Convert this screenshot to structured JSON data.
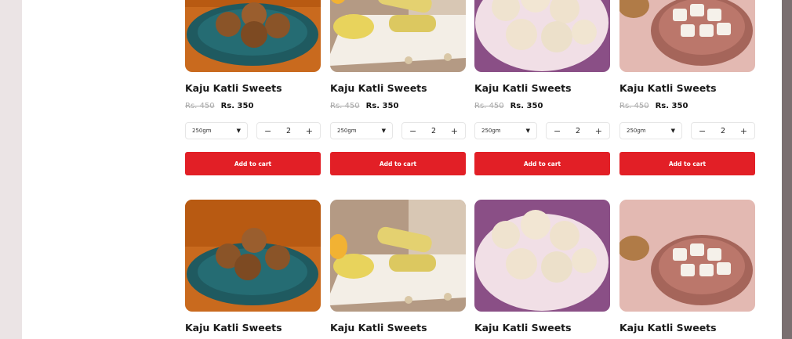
{
  "products_row1": [
    {
      "title": "Kaju Katli Sweets",
      "old_price": "Rs. 450",
      "new_price": "Rs. 350",
      "weight": "250gm",
      "qty": "2",
      "cart_label": "Add to cart",
      "image": "laddoo-plate"
    },
    {
      "title": "Kaju Katli Sweets",
      "old_price": "Rs. 450",
      "new_price": "Rs. 350",
      "weight": "250gm",
      "qty": "2",
      "cart_label": "Add to cart",
      "image": "roll-sweets"
    },
    {
      "title": "Kaju Katli Sweets",
      "old_price": "Rs. 450",
      "new_price": "Rs. 350",
      "weight": "250gm",
      "qty": "2",
      "cart_label": "Add to cart",
      "image": "white-laddoo"
    },
    {
      "title": "Kaju Katli Sweets",
      "old_price": "Rs. 450",
      "new_price": "Rs. 350",
      "weight": "250gm",
      "qty": "2",
      "cart_label": "Add to cart",
      "image": "barfi-plate"
    }
  ],
  "products_row2": [
    {
      "title": "Kaju Katli Sweets",
      "image": "laddoo-plate"
    },
    {
      "title": "Kaju Katli Sweets",
      "image": "roll-sweets"
    },
    {
      "title": "Kaju Katli Sweets",
      "image": "white-laddoo"
    },
    {
      "title": "Kaju Katli Sweets",
      "image": "barfi-plate"
    }
  ],
  "icons": {
    "dropdown": "chevron-down-icon",
    "minus": "minus-icon",
    "plus": "plus-icon"
  },
  "symbols": {
    "caret": "▼",
    "minus": "−",
    "plus": "+"
  },
  "colors": {
    "accent": "#e21f26",
    "page_bg": "#ebe4e5"
  }
}
